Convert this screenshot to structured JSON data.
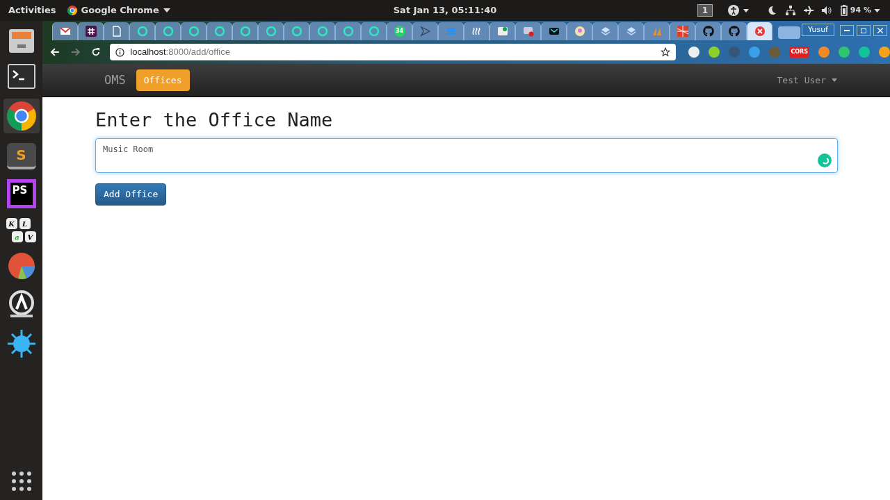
{
  "topbar": {
    "activities": "Activities",
    "app": "Google Chrome",
    "clock": "Sat Jan 13, 05:11:40",
    "workspace": "1",
    "battery": "94 %"
  },
  "dock": {
    "sublime": "S",
    "phpstorm": "PS",
    "keys": [
      "K",
      "L",
      "a",
      "V"
    ]
  },
  "browser": {
    "tabs": [
      {
        "selected": false
      },
      {
        "selected": false
      },
      {
        "selected": false
      },
      {
        "selected": false
      },
      {
        "selected": false
      },
      {
        "selected": false
      },
      {
        "selected": false
      },
      {
        "selected": false
      },
      {
        "selected": false
      },
      {
        "selected": false
      },
      {
        "selected": false
      },
      {
        "selected": false
      },
      {
        "selected": false
      },
      {
        "selected": false
      },
      {
        "selected": false
      },
      {
        "selected": false
      },
      {
        "selected": false
      },
      {
        "selected": false
      },
      {
        "selected": false
      },
      {
        "selected": false
      },
      {
        "selected": false
      },
      {
        "selected": false
      },
      {
        "selected": false
      },
      {
        "selected": false
      },
      {
        "selected": false
      },
      {
        "selected": false
      },
      {
        "selected": false
      },
      {
        "selected": true
      }
    ],
    "tab_badge": "34",
    "profile": "Yusuf",
    "url_host": "localhost",
    "url_path": ":8000/add/office",
    "cors": "CORS"
  },
  "navbar": {
    "brand": "OMS",
    "items": [
      {
        "label": "Offices",
        "selected": true
      }
    ],
    "user": "Test User"
  },
  "form": {
    "heading": "Enter the Office Name",
    "value": "Music Room",
    "button": "Add Office"
  }
}
